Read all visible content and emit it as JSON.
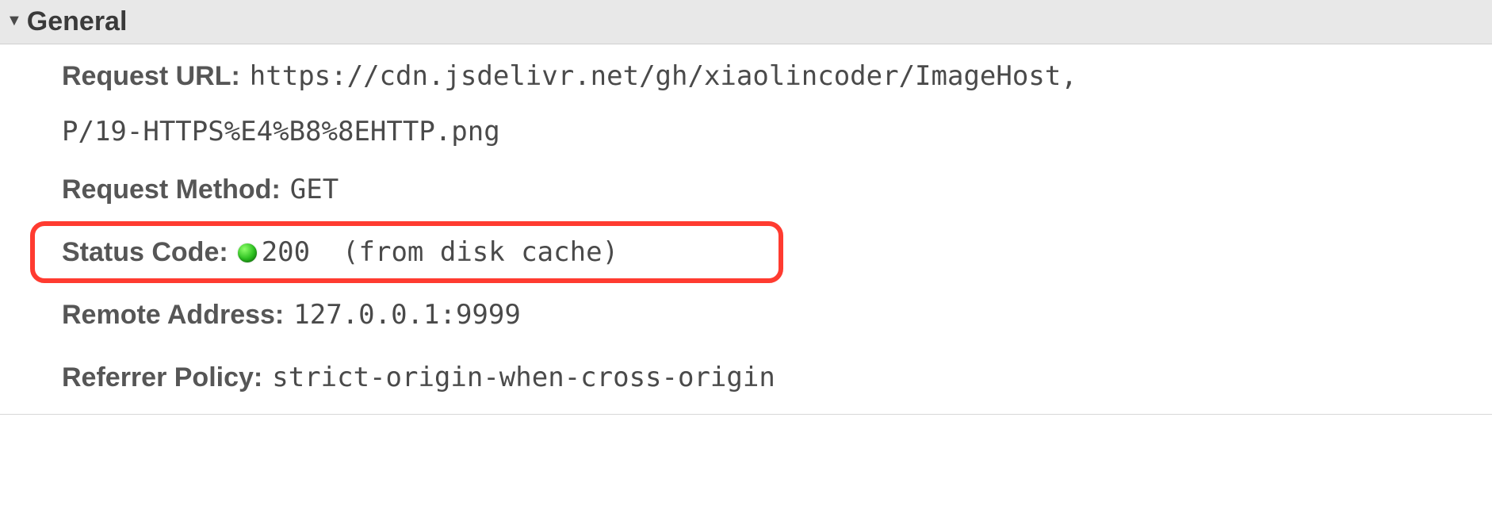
{
  "section": {
    "title": "General"
  },
  "general": {
    "request_url": {
      "label": "Request URL:",
      "line1": "https://cdn.jsdelivr.net/gh/xiaolincoder/ImageHost,",
      "line2": "P/19-HTTPS%E4%B8%8EHTTP.png"
    },
    "request_method": {
      "label": "Request Method:",
      "value": "GET"
    },
    "status_code": {
      "label": "Status Code:",
      "code": "200",
      "hint": "  (from disk cache)"
    },
    "remote_address": {
      "label": "Remote Address:",
      "value": "127.0.0.1:9999"
    },
    "referrer_policy": {
      "label": "Referrer Policy:",
      "value": "strict-origin-when-cross-origin"
    }
  }
}
